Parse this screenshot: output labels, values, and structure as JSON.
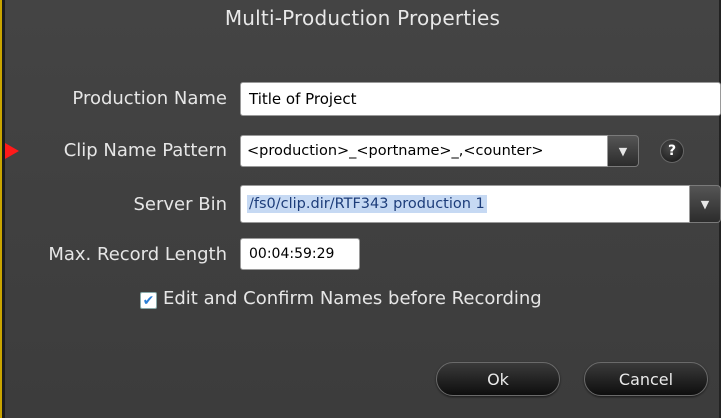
{
  "dialog": {
    "title": "Multi-Production Properties"
  },
  "fields": {
    "production_name": {
      "label": "Production Name",
      "value": "Title of Project"
    },
    "clip_name_pattern": {
      "label": "Clip Name Pattern",
      "value": "<production>_<portname>_,<counter>",
      "help": "?"
    },
    "server_bin": {
      "label": "Server Bin",
      "value": "/fs0/clip.dir/RTF343 production 1"
    },
    "max_record_length": {
      "label": "Max. Record Length",
      "value": "00:04:59:29"
    }
  },
  "options": {
    "confirm_names": {
      "label": "Edit and Confirm Names before Recording",
      "checked": true,
      "mark": "✔"
    }
  },
  "buttons": {
    "ok": "Ok",
    "cancel": "Cancel"
  },
  "icons": {
    "dropdown": "▼",
    "pointer": "red-arrow-pointer"
  },
  "colors": {
    "accent": "#c9a400",
    "pointer": "#ff1a1a",
    "selection": "#c6d9f3"
  }
}
